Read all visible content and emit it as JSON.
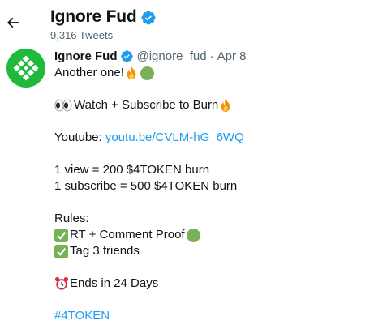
{
  "header": {
    "display_name": "Ignore Fud",
    "tweet_count": "9,316 Tweets",
    "icons": {
      "back": "arrow-left-icon",
      "verified": "verified-badge-icon"
    }
  },
  "tweet": {
    "author_name": "Ignore Fud",
    "handle": "@ignore_fud",
    "separator": "·",
    "date": "Apr 8",
    "avatar_icon": "green-logo-avatar",
    "lines": {
      "l1": "Another one!",
      "l2": "Watch + Subscribe to Burn",
      "l3_prefix": "Youtube: ",
      "l3_link": "youtu.be/CVLM-hG_6WQ",
      "l4": "1 view = 200 $4TOKEN burn",
      "l5": "1 subscribe = 500 $4TOKEN burn",
      "l6": "Rules:",
      "l7": "RT + Comment Proof",
      "l8": "Tag 3 friends",
      "l9": "Ends in 24 Days",
      "l10_hashtag": "#4TOKEN"
    }
  },
  "colors": {
    "text": "#0f1419",
    "secondary": "#536471",
    "link": "#1d9bf0",
    "verified": "#1d9bf0",
    "avatar_bg": "#1fba3b"
  }
}
